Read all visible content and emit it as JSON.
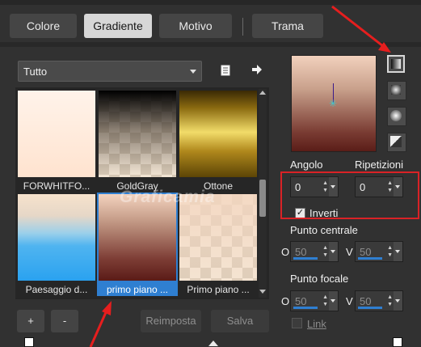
{
  "tabs": [
    {
      "label": "Colore"
    },
    {
      "label": "Gradiente"
    },
    {
      "label": "Motivo"
    },
    {
      "label": "Trama"
    }
  ],
  "active_tab": "Gradiente",
  "category": {
    "selected": "Tutto"
  },
  "gradients": [
    {
      "name": "FORWHITFO..."
    },
    {
      "name": "GoldGray"
    },
    {
      "name": "Ottone"
    },
    {
      "name": "Paesaggio d..."
    },
    {
      "name": "primo piano ..."
    },
    {
      "name": "Primo piano ..."
    }
  ],
  "buttons": {
    "add": "+",
    "remove": "-",
    "reset": "Reimposta",
    "save": "Salva"
  },
  "watermark": "Graficamia",
  "controls": {
    "angle_label": "Angolo",
    "angle_value": "0",
    "repeats_label": "Ripetizioni",
    "repeats_value": "0",
    "invert_label": "Inverti",
    "invert_checked": true,
    "center_label": "Punto centrale",
    "center_h_label": "O",
    "center_h_value": "50",
    "center_v_label": "V",
    "center_v_value": "50",
    "focal_label": "Punto focale",
    "focal_h_label": "O",
    "focal_h_value": "50",
    "focal_v_label": "V",
    "focal_v_value": "50",
    "link_label": "Link",
    "link_checked": false
  },
  "colors": {
    "accent": "#2f7fd1",
    "annotation": "#e61e1e",
    "marker": "#3fd0d0"
  }
}
